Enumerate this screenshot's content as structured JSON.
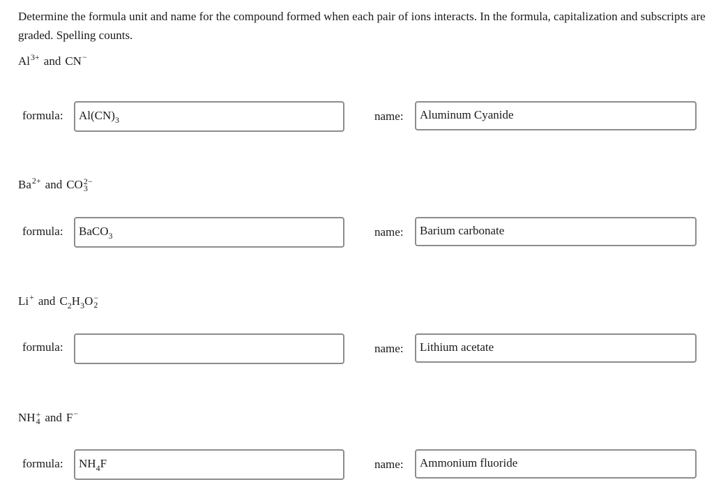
{
  "instructions": "Determine the formula unit and name for the compound formed when each pair of ions interacts. In the formula, capitalization and subscripts are graded. Spelling counts.",
  "labels": {
    "formula": "formula:",
    "name": "name:",
    "and": "and"
  },
  "questions": [
    {
      "cation": {
        "symbol": "Al",
        "charge": "3+"
      },
      "anion": {
        "symbol": "CN",
        "charge": "−"
      },
      "formula": {
        "parts": [
          {
            "t": "Al(CN)"
          },
          {
            "sub": "3"
          }
        ],
        "text": "Al(CN)3"
      },
      "name": "Aluminum Cyanide"
    },
    {
      "cation": {
        "symbol": "Ba",
        "charge": "2+"
      },
      "anion": {
        "symbol": "CO",
        "sub": "3",
        "charge": "2−"
      },
      "formula": {
        "parts": [
          {
            "t": "BaCO"
          },
          {
            "sub": "3"
          }
        ],
        "text": "BaCO3"
      },
      "name": "Barium carbonate"
    },
    {
      "cation": {
        "symbol": "Li",
        "charge": "+"
      },
      "anion": {
        "parts": [
          {
            "t": "C"
          },
          {
            "sub": "2"
          },
          {
            "t": "H"
          },
          {
            "sub": "3"
          },
          {
            "t": "O"
          }
        ],
        "sub": "2",
        "charge": "−"
      },
      "formula": {
        "parts": [],
        "text": ""
      },
      "name": "Lithium acetate"
    },
    {
      "cation": {
        "symbol": "NH",
        "sub": "4",
        "charge": "+"
      },
      "anion": {
        "symbol": "F",
        "charge": "−"
      },
      "formula": {
        "parts": [
          {
            "t": "NH"
          },
          {
            "sub": "4"
          },
          {
            "t": "F"
          }
        ],
        "text": "NH4F"
      },
      "name": "Ammonium fluoride"
    }
  ]
}
